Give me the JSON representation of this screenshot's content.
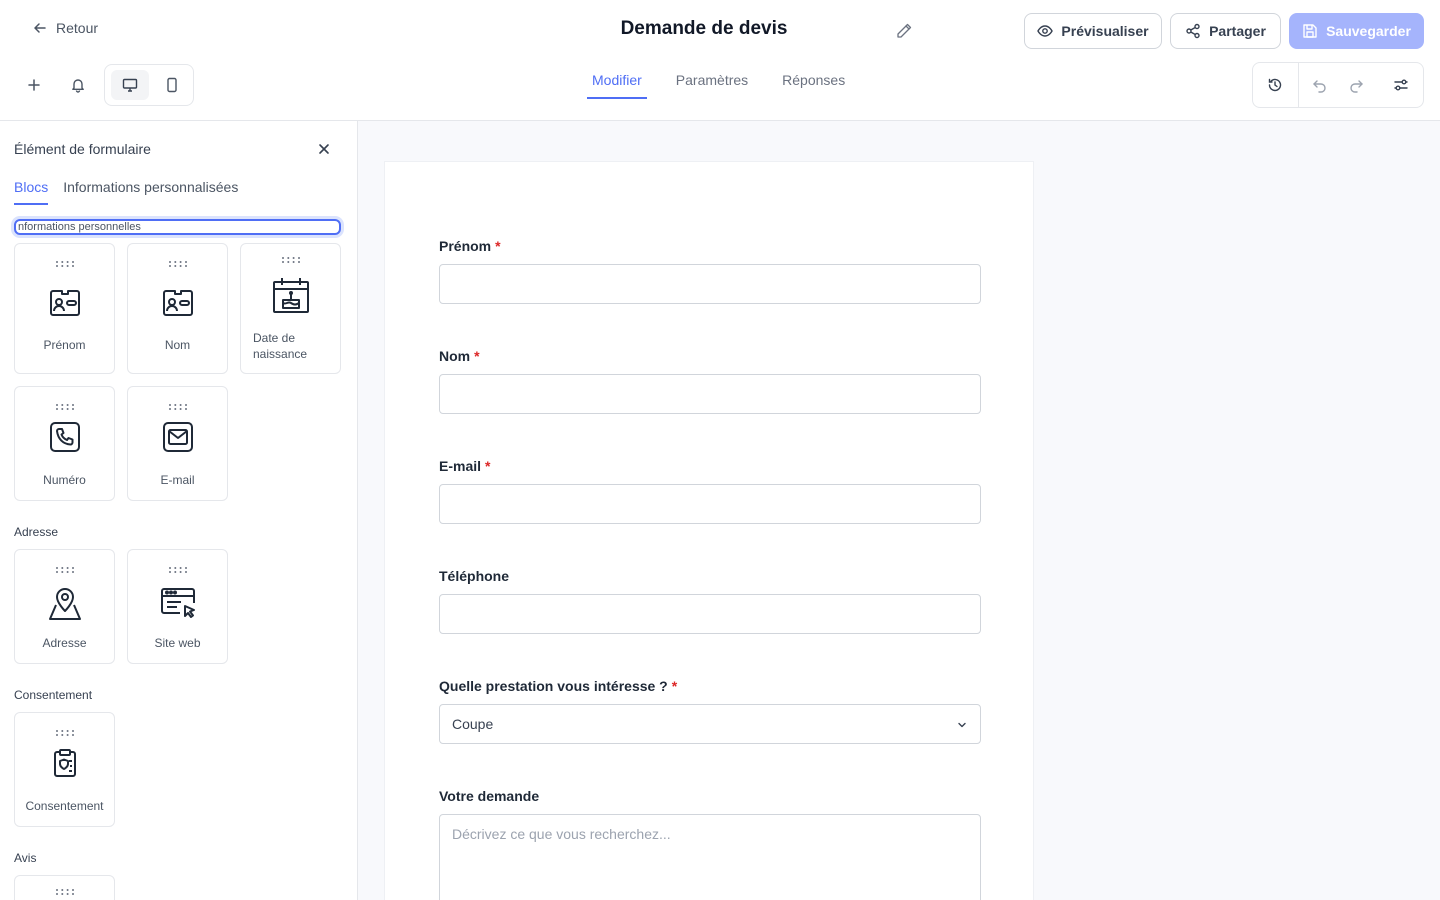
{
  "header": {
    "back_label": "Retour",
    "title": "Demande de devis",
    "preview_label": "Prévisualiser",
    "share_label": "Partager",
    "save_label": "Sauvegarder"
  },
  "tabs": [
    {
      "label": "Modifier",
      "active": true
    },
    {
      "label": "Paramètres",
      "active": false
    },
    {
      "label": "Réponses",
      "active": false
    }
  ],
  "sidebar": {
    "title": "Élément de formulaire",
    "tabs": [
      "Blocs",
      "Informations personnalisées"
    ],
    "section_input_value": "nformations personnelles",
    "sections": [
      {
        "title": "",
        "blocks": [
          "Prénom",
          "Nom",
          "Date de naissance",
          "Numéro",
          "E-mail"
        ]
      },
      {
        "title": "Adresse",
        "blocks": [
          "Adresse",
          "Site web"
        ]
      },
      {
        "title": "Consentement",
        "blocks": [
          "Consentement"
        ]
      },
      {
        "title": "Avis",
        "blocks": []
      }
    ]
  },
  "form": {
    "fields": [
      {
        "label": "Prénom",
        "required": true,
        "type": "text",
        "value": ""
      },
      {
        "label": "Nom",
        "required": true,
        "type": "text",
        "value": ""
      },
      {
        "label": "E-mail",
        "required": true,
        "type": "text",
        "value": ""
      },
      {
        "label": "Téléphone",
        "required": false,
        "type": "text",
        "value": ""
      },
      {
        "label": "Quelle prestation vous intéresse ?",
        "required": true,
        "type": "select",
        "value": "Coupe"
      },
      {
        "label": "Votre demande",
        "required": false,
        "type": "textarea",
        "placeholder": "Décrivez ce que vous recherchez..."
      }
    ],
    "required_mark": "*"
  },
  "colors": {
    "accent": "#4f6ef5",
    "save_disabled": "#a5b4fc",
    "required": "#dc2626",
    "canvas_bg": "#f8f9fc"
  }
}
